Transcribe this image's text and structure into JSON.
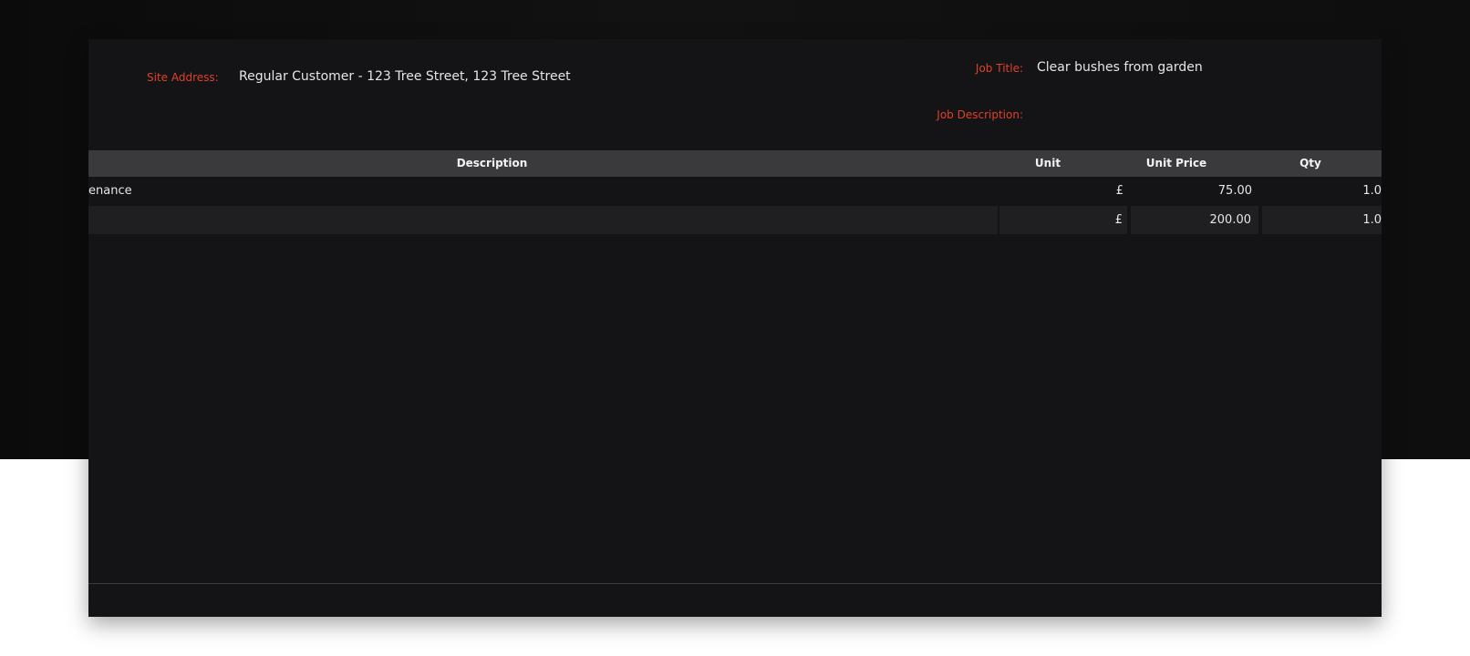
{
  "header": {
    "site_address_label": "Site Address:",
    "site_address_value": "Regular Customer - 123 Tree Street, 123 Tree Street",
    "job_title_label": "Job Title:",
    "job_title_value": "Clear bushes from garden",
    "job_description_label": "Job Description:"
  },
  "table": {
    "columns": [
      "Description",
      "Unit",
      "Unit Price",
      "Qty"
    ],
    "rows": [
      {
        "description": "enance",
        "currency": "£",
        "unit_price": "75.00",
        "qty": "1.0"
      },
      {
        "description": "",
        "currency": "£",
        "unit_price": "200.00",
        "qty": "1.0"
      }
    ]
  }
}
